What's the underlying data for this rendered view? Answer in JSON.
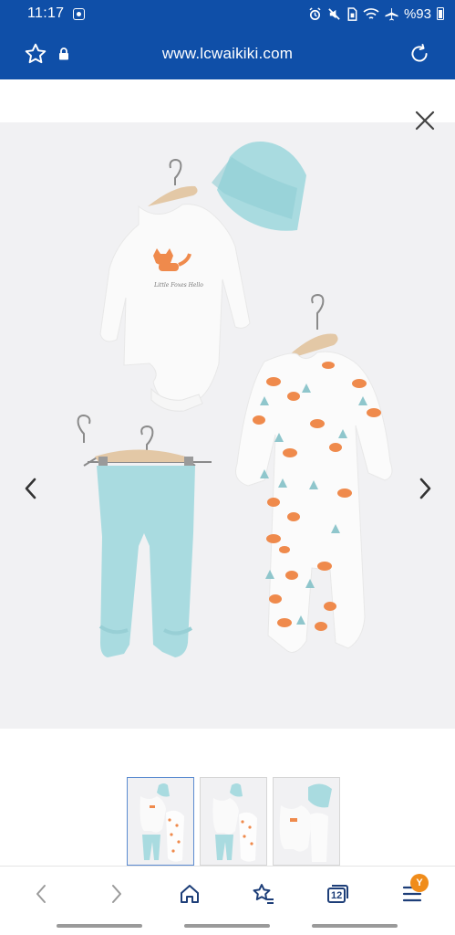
{
  "status_bar": {
    "time": "11:17",
    "battery_text": "%93",
    "icons": [
      "alarm-icon",
      "mute-icon",
      "sim-icon",
      "wifi-icon",
      "airplane-icon",
      "battery-icon"
    ]
  },
  "browser": {
    "url": "www.lcwaikiki.com",
    "icons": [
      "bookmark-star-icon",
      "lock-icon",
      "reload-icon"
    ]
  },
  "gallery": {
    "image_alt": "",
    "thumbnail_count": 3,
    "active_thumbnail": 1,
    "icons": [
      "close-icon",
      "chevron-left-icon",
      "chevron-right-icon"
    ]
  },
  "image_print": {
    "bodysuit_text": "Little Foxes Hello"
  },
  "bottom_nav": {
    "tab_count": "12",
    "menu_badge": "Y",
    "icons": [
      "back-icon",
      "forward-icon",
      "home-icon",
      "bookmarks-icon",
      "tabs-icon",
      "menu-icon"
    ]
  },
  "colors": {
    "header_blue": "#0f4fa8",
    "image_bg": "#f1f1f3",
    "mint": "#a9dbe0",
    "fox_orange": "#ef8a4c",
    "badge_orange": "#f08c1a"
  }
}
